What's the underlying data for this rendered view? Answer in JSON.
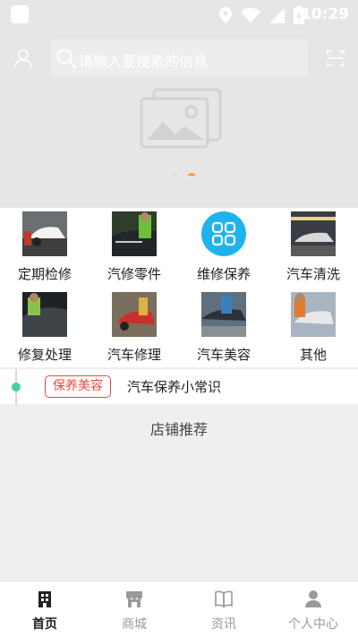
{
  "status_bar": {
    "time": "10:29"
  },
  "search": {
    "placeholder": "请输入要搜索的信息"
  },
  "banner": {
    "dots": 2,
    "active_dot": 2
  },
  "grid": [
    {
      "label": "定期检修",
      "icon": "car-inspection-photo"
    },
    {
      "label": "汽修零件",
      "icon": "car-parts-photo"
    },
    {
      "label": "维修保养",
      "icon": "grid-app-icon"
    },
    {
      "label": "汽车清洗",
      "icon": "car-wash-photo"
    },
    {
      "label": "修复处理",
      "icon": "car-repair-photo"
    },
    {
      "label": "汽车修理",
      "icon": "car-fix-photo"
    },
    {
      "label": "汽车美容",
      "icon": "car-beauty-photo"
    },
    {
      "label": "其他",
      "icon": "car-other-photo"
    }
  ],
  "ticker": {
    "tag": "保养美容",
    "headline": "汽车保养小常识"
  },
  "section": {
    "title": "店铺推荐"
  },
  "bottom_nav": [
    {
      "label": "首页",
      "active": true
    },
    {
      "label": "商城",
      "active": false
    },
    {
      "label": "资讯",
      "active": false
    },
    {
      "label": "个人中心",
      "active": false
    }
  ],
  "colors": {
    "accent": "#f39a3b",
    "tag_red": "#e14b3e",
    "icon_blue": "#1fb3ee",
    "timeline_green": "#40d2a0"
  }
}
